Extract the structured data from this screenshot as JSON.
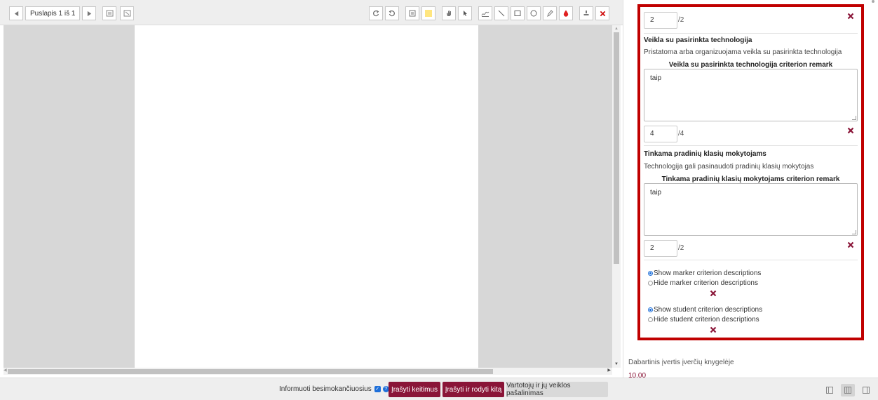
{
  "toolbar": {
    "page_label": "Puslapis 1 iš 1"
  },
  "criteria": [
    {
      "grade_value": "2",
      "grade_max": "/2"
    },
    {
      "title": "Veikla su pasirinkta technologija",
      "description": "Pristatoma arba organizuojama veikla su pasirinkta technologija",
      "remark_label": "Veikla su pasirinkta technologija criterion remark",
      "remark_value": "taip",
      "grade_value": "4",
      "grade_max": "/4"
    },
    {
      "title": "Tinkama pradinių klasių mokytojams",
      "description": "Technologija gali pasinaudoti pradinių klasių mokytojas",
      "remark_label": "Tinkama pradinių klasių mokytojams criterion remark",
      "remark_value": "taip",
      "grade_value": "2",
      "grade_max": "/2"
    }
  ],
  "options": {
    "show_marker": "Show marker criterion descriptions",
    "hide_marker": "Hide marker criterion descriptions",
    "show_student": "Show student criterion descriptions",
    "hide_student": "Hide student criterion descriptions"
  },
  "gradebook": {
    "label": "Dabartinis įvertis įverčių knygelėje",
    "value": "10.00"
  },
  "footer": {
    "notify_label": "Informuoti besimokančiuosius",
    "save_label": "Įrašyti keitimus",
    "save_next_label": "Įrašyti ir rodyti kitą",
    "reset_label": "Vartotojų ir jų veiklos pašalinimas"
  },
  "colors": {
    "accent": "#8a1538",
    "highlight_border": "#c00000",
    "checkbox": "#1e6fd9",
    "delete_icon": "#8a1538"
  },
  "icons": {
    "delete": "x-cross-icon",
    "prev_page": "triangle-left-icon",
    "next_page": "triangle-right-icon"
  }
}
